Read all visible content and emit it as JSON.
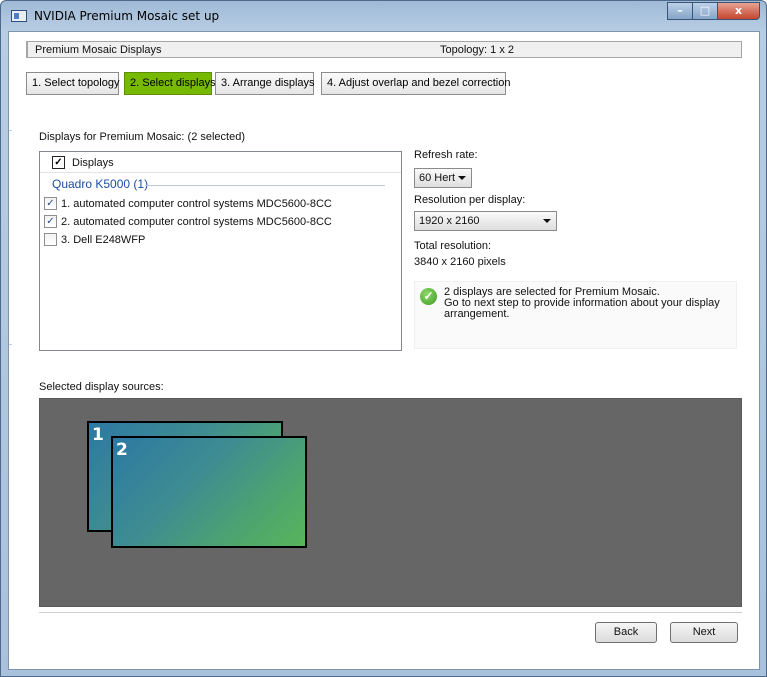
{
  "window": {
    "title": "NVIDIA Premium Mosaic set up",
    "minimize_glyph": "–",
    "maximize_glyph": "□",
    "close_glyph": "x"
  },
  "header": {
    "left_label": "Premium Mosaic Displays",
    "topology": "Topology: 1 x 2"
  },
  "steps": [
    {
      "label": "1. Select topology",
      "active": false
    },
    {
      "label": "2. Select displays",
      "active": true
    },
    {
      "label": "3. Arrange displays",
      "active": false
    },
    {
      "label": "4. Adjust overlap and bezel correction",
      "active": false
    }
  ],
  "displays_section": {
    "label": "Displays for Premium Mosaic: (2 selected)",
    "header_label": "Displays",
    "header_checked": true,
    "group_title": "Quadro K5000 (1)",
    "items": [
      {
        "label": "1. automated computer control systems MDC5600-8CC",
        "checked": true
      },
      {
        "label": "2. automated computer control systems MDC5600-8CC",
        "checked": true
      },
      {
        "label": "3. Dell E248WFP",
        "checked": false
      }
    ]
  },
  "settings": {
    "refresh_label": "Refresh rate:",
    "refresh_value": "60 Hert",
    "resolution_label": "Resolution per display:",
    "resolution_value": "1920 x 2160",
    "total_label": "Total resolution:",
    "total_value": "3840 x 2160 pixels"
  },
  "info": {
    "line1": "2 displays are selected for Premium Mosaic.",
    "line2": "Go to next step to provide information about your display",
    "line3": "arrangement."
  },
  "sources": {
    "label": "Selected display sources:",
    "monitors": [
      "1",
      "2"
    ]
  },
  "buttons": {
    "back": "Back",
    "next": "Next"
  },
  "colors": {
    "accent_green": "#77b900",
    "canvas_gray": "#666666",
    "group_title_blue": "#1e4ea3"
  }
}
